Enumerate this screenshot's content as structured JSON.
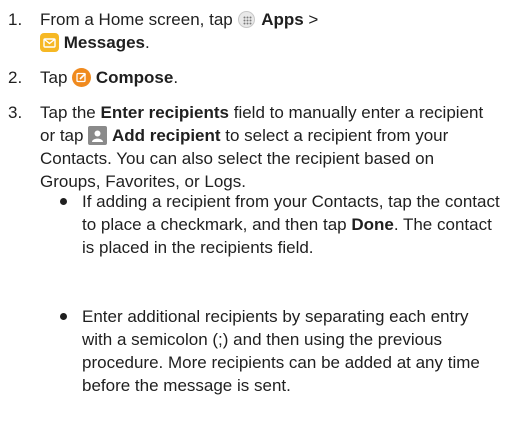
{
  "steps": [
    {
      "number": "1.",
      "line1_prefix": "From a Home screen, tap ",
      "apps_icon": "apps-grid-icon",
      "apps_label": "Apps",
      "line1_suffix": " >",
      "messages_icon": "messages-icon",
      "messages_label": "Messages",
      "line2_suffix": "."
    },
    {
      "number": "2.",
      "prefix": "Tap ",
      "compose_icon": "compose-icon",
      "compose_label": "Compose",
      "suffix": "."
    },
    {
      "number": "3.",
      "prefix": "Tap the ",
      "field_label": "Enter recipients",
      "mid1": " field to manually enter a recipient or tap ",
      "contact_icon": "contact-icon",
      "add_label": "Add recipient",
      "mid2": " to select a recipient from your Contacts. You can also select the recipient based on Groups, Favorites, or Logs."
    }
  ],
  "bullets": [
    {
      "prefix": "If adding a recipient from your Contacts, tap the contact to place a checkmark, and then tap ",
      "bold": "Done",
      "suffix": ". The contact is placed in the recipients field."
    },
    {
      "text": "Enter additional recipients by separating each entry with a semicolon (;) and then using the previous procedure. More recipients can be added at any time before the message is sent."
    }
  ],
  "colors": {
    "text": "#1f1f1f",
    "messages_icon": "#f6b824",
    "compose_icon": "#f08a1e",
    "contact_icon": "#8a8a8a"
  }
}
